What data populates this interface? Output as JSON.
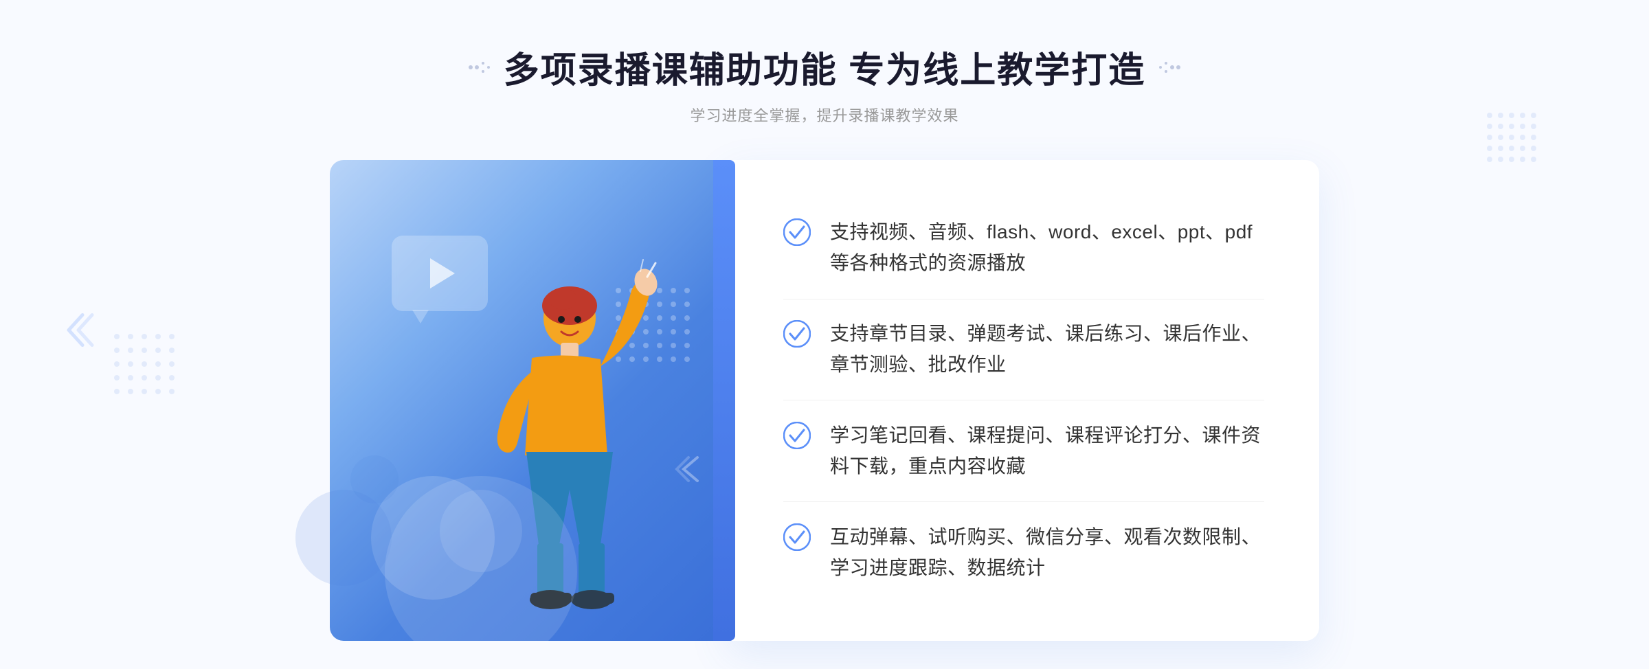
{
  "header": {
    "title": "多项录播课辅助功能 专为线上教学打造",
    "subtitle": "学习进度全掌握，提升录播课教学效果",
    "decorator_left": "❋",
    "decorator_right": "❋"
  },
  "features": [
    {
      "id": 1,
      "text": "支持视频、音频、flash、word、excel、ppt、pdf等各种格式的资源播放"
    },
    {
      "id": 2,
      "text": "支持章节目录、弹题考试、课后练习、课后作业、章节测验、批改作业"
    },
    {
      "id": 3,
      "text": "学习笔记回看、课程提问、课程评论打分、课件资料下载，重点内容收藏"
    },
    {
      "id": 4,
      "text": "互动弹幕、试听购买、微信分享、观看次数限制、学习进度跟踪、数据统计"
    }
  ],
  "colors": {
    "accent_blue": "#4a7fe0",
    "light_blue": "#7baef0",
    "check_color": "#5b8ff9",
    "text_dark": "#333333",
    "text_gray": "#999999"
  }
}
